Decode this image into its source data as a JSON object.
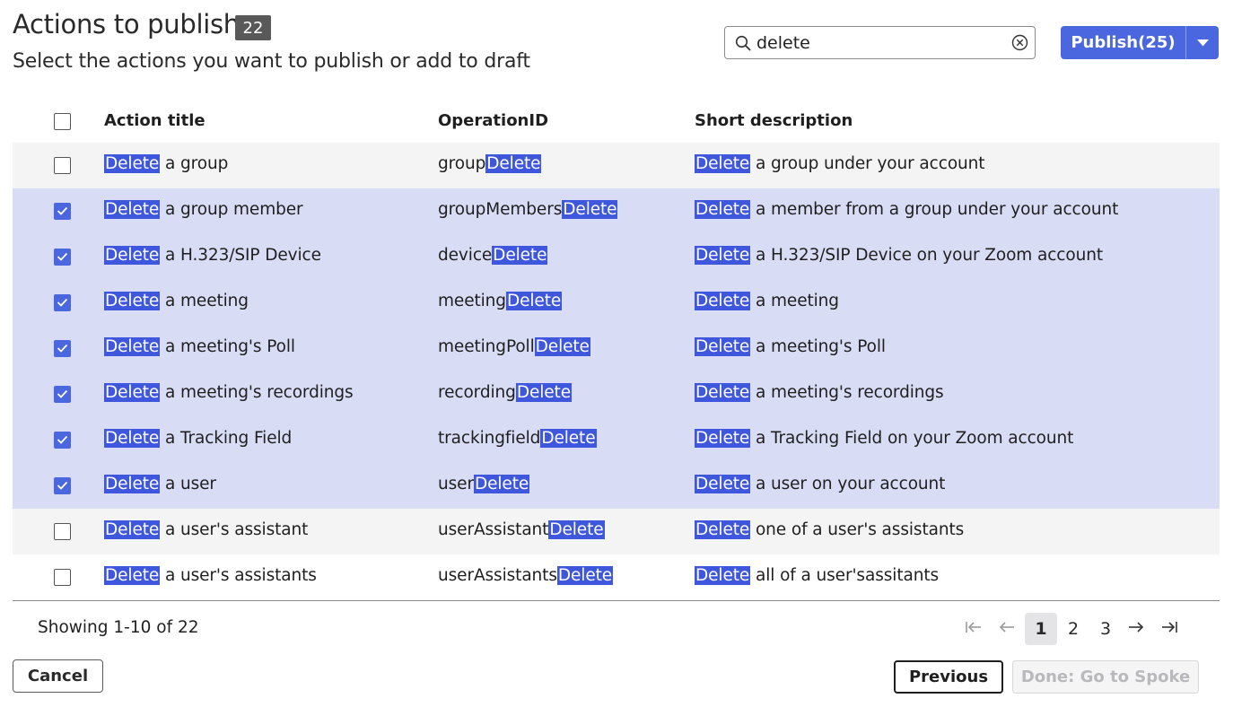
{
  "header": {
    "title": "Actions to publish",
    "count": "22",
    "subtitle": "Select the actions you want to publish or add to draft"
  },
  "search": {
    "value": "delete",
    "icon": "search-icon",
    "clear_icon": "clear-circle-icon"
  },
  "publish": {
    "label": "Publish(25)",
    "caret_icon": "caret-down-icon",
    "color": "#4a67e0"
  },
  "table": {
    "columns": [
      "Action title",
      "OperationID",
      "Short description"
    ],
    "highlight_term": "Delete",
    "highlight_color": "#3e57dc",
    "selected_row_color": "#d9dcf5",
    "rows": [
      {
        "checked": false,
        "title": [
          "Delete",
          " a group"
        ],
        "op": [
          "group",
          "Delete"
        ],
        "desc": [
          "Delete",
          " a group under your account"
        ]
      },
      {
        "checked": true,
        "title": [
          "Delete",
          " a group member"
        ],
        "op": [
          "groupMembers",
          "Delete"
        ],
        "desc": [
          "Delete",
          " a member from a group under your account"
        ]
      },
      {
        "checked": true,
        "title": [
          "Delete",
          " a H.323/SIP Device"
        ],
        "op": [
          "device",
          "Delete"
        ],
        "desc": [
          "Delete",
          " a H.323/SIP Device on your Zoom account"
        ]
      },
      {
        "checked": true,
        "title": [
          "Delete",
          " a meeting"
        ],
        "op": [
          "meeting",
          "Delete"
        ],
        "desc": [
          "Delete",
          " a meeting"
        ]
      },
      {
        "checked": true,
        "title": [
          "Delete",
          " a meeting's Poll"
        ],
        "op": [
          "meetingPoll",
          "Delete"
        ],
        "desc": [
          "Delete",
          " a meeting's Poll"
        ]
      },
      {
        "checked": true,
        "title": [
          "Delete",
          " a meeting's recordings"
        ],
        "op": [
          "recording",
          "Delete"
        ],
        "desc": [
          "Delete",
          " a meeting's recordings"
        ]
      },
      {
        "checked": true,
        "title": [
          "Delete",
          " a Tracking Field"
        ],
        "op": [
          "trackingfield",
          "Delete"
        ],
        "desc": [
          "Delete",
          " a Tracking Field on your Zoom account"
        ]
      },
      {
        "checked": true,
        "title": [
          "Delete",
          " a user"
        ],
        "op": [
          "user",
          "Delete"
        ],
        "desc": [
          "Delete",
          " a user on your account"
        ]
      },
      {
        "checked": false,
        "title": [
          "Delete",
          " a user's assistant"
        ],
        "op": [
          "userAssistant",
          "Delete"
        ],
        "desc": [
          "Delete",
          " one of a user's assistants"
        ]
      },
      {
        "checked": false,
        "title": [
          "Delete",
          " a user's assistants"
        ],
        "op": [
          "userAssistants",
          "Delete"
        ],
        "desc": [
          "Delete",
          " all of a user'sassitants"
        ]
      }
    ]
  },
  "pagination": {
    "showing": "Showing 1-10 of 22",
    "pages": [
      "1",
      "2",
      "3"
    ],
    "current": "1",
    "icons": [
      "first-page-icon",
      "prev-page-icon",
      "next-page-icon",
      "last-page-icon"
    ]
  },
  "footer": {
    "cancel_label": "Cancel",
    "previous_label": "Previous",
    "done_label": "Done: Go to Spoke"
  }
}
